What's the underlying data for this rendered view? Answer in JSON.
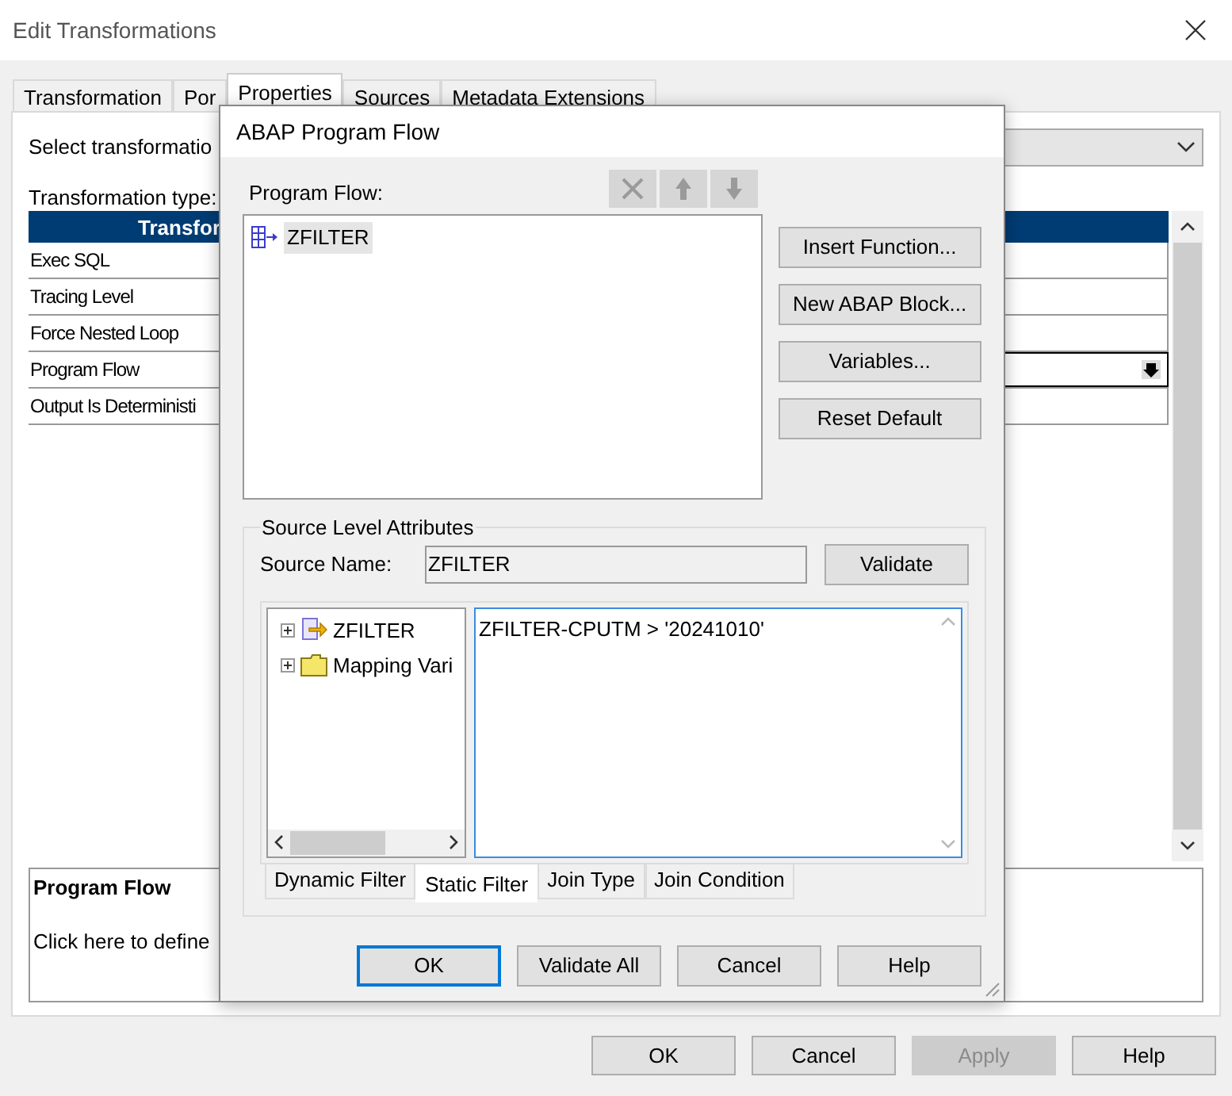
{
  "window": {
    "title": "Edit Transformations"
  },
  "tabs": [
    {
      "label": "Transformation",
      "selected": false
    },
    {
      "label": "Por",
      "selected": false
    },
    {
      "label": "Properties",
      "selected": true
    },
    {
      "label": "Sources",
      "selected": false
    },
    {
      "label": "Metadata Extensions",
      "selected": false
    }
  ],
  "select_label": "Select transformatio",
  "type_label": "Transformation type:",
  "table": {
    "columns": [
      "Transfor"
    ],
    "rows": [
      {
        "name": "Exec SQL",
        "kind": "text"
      },
      {
        "name": "Tracing Level",
        "kind": "text"
      },
      {
        "name": "Force Nested Loop",
        "kind": "text"
      },
      {
        "name": "Program Flow",
        "kind": "picker"
      },
      {
        "name": "Output Is Deterministi",
        "kind": "text"
      }
    ]
  },
  "description": {
    "title": "Program Flow",
    "text": "Click here to define"
  },
  "buttons": [
    {
      "label": "OK",
      "disabled": false
    },
    {
      "label": "Cancel",
      "disabled": false
    },
    {
      "label": "Apply",
      "disabled": true
    },
    {
      "label": "Help",
      "disabled": false
    }
  ],
  "dialog": {
    "title": "ABAP Program Flow",
    "flow_label": "Program Flow:",
    "toolbar": [
      {
        "kind": "delete",
        "disabled": true
      },
      {
        "kind": "up",
        "disabled": true
      },
      {
        "kind": "down",
        "disabled": true
      }
    ],
    "flow_items": [
      {
        "label": "ZFILTER",
        "selected": true
      }
    ],
    "side_buttons": [
      "Insert Function...",
      "New ABAP Block...",
      "Variables...",
      "Reset Default"
    ],
    "source_group": {
      "title": "Source Level Attributes",
      "source_name_label": "Source Name:",
      "source_name": "ZFILTER",
      "validate": "Validate",
      "tree": [
        {
          "label": "ZFILTER",
          "kind": "source",
          "expanded": false
        },
        {
          "label": "Mapping Vari",
          "kind": "folder",
          "expanded": false
        }
      ],
      "filter_text": "ZFILTER-CPUTM > '20241010'",
      "tabs": [
        {
          "label": "Dynamic Filter",
          "selected": false
        },
        {
          "label": "Static Filter",
          "selected": true
        },
        {
          "label": "Join Type",
          "selected": false
        },
        {
          "label": "Join Condition",
          "selected": false
        }
      ]
    },
    "buttons": [
      {
        "label": "OK",
        "default": true
      },
      {
        "label": "Validate All",
        "default": false
      },
      {
        "label": "Cancel",
        "default": false
      },
      {
        "label": "Help",
        "default": false
      }
    ]
  }
}
